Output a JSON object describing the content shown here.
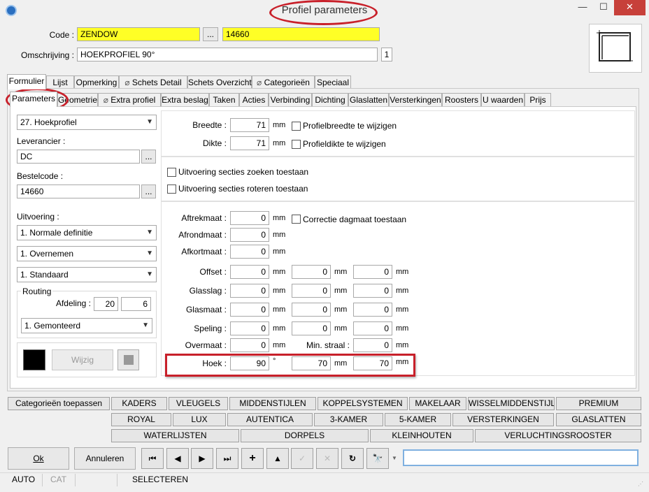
{
  "window": {
    "title": "Profiel parameters",
    "minimize": "—",
    "maximize": "☐",
    "close": "✕"
  },
  "header": {
    "code_label": "Code :",
    "code_value": "ZENDOW",
    "code_browse": "...",
    "code_number": "14660",
    "omschrijving_label": "Omschrijving :",
    "omschrijving_value": "HOEKPROFIEL 90°",
    "omschrijving_count": "1"
  },
  "tabs_main": [
    "Formulier",
    "Lijst",
    "Opmerking",
    "Schets Detail",
    "Schets Overzicht",
    "Categorieën",
    "Speciaal"
  ],
  "tabs_sub": [
    "Parameters",
    "Geometrie",
    "Extra profiel",
    "Extra beslag",
    "Taken",
    "Acties",
    "Verbinding",
    "Dichting",
    "Glaslatten",
    "Versterkingen",
    "Roosters",
    "U waarden",
    "Prijs"
  ],
  "left": {
    "profile_type": "27. Hoekprofiel",
    "leverancier_label": "Leverancier :",
    "leverancier_value": "DC",
    "bestelcode_label": "Bestelcode :",
    "bestelcode_value": "14660",
    "browse": "...",
    "uitvoering_label": "Uitvoering :",
    "uitvoering_1": "1.  Normale definitie",
    "uitvoering_2": "1.  Overnemen",
    "uitvoering_3": "1.  Standaard",
    "routing_label": "Routing",
    "afdeling_label": "Afdeling :",
    "afdeling_1": "20",
    "afdeling_2": "6",
    "routing_select": "1.  Gemonteerd",
    "wijzig_label": "Wijzig"
  },
  "right": {
    "breedte_label": "Breedte :",
    "breedte_value": "71",
    "dikte_label": "Dikte :",
    "dikte_value": "71",
    "unit_mm": "mm",
    "chk_breedte": "Profielbreedte te wijzigen",
    "chk_dikte": "Profieldikte te wijzigen",
    "chk_zoeken": "Uitvoering secties zoeken toestaan",
    "chk_roteren": "Uitvoering secties roteren toestaan",
    "aftrekmaat_label": "Aftrekmaat :",
    "aftrekmaat": "0",
    "chk_correctie": "Correctie dagmaat toestaan",
    "afrondmaat_label": "Afrondmaat :",
    "afrondmaat": "0",
    "afkortmaat_label": "Afkortmaat :",
    "afkortmaat": "0",
    "offset_label": "Offset :",
    "offset": [
      "0",
      "0",
      "0"
    ],
    "glasslag_label": "Glasslag :",
    "glasslag": [
      "0",
      "0",
      "0"
    ],
    "glasmaat_label": "Glasmaat :",
    "glasmaat": [
      "0",
      "0",
      "0"
    ],
    "speling_label": "Speling :",
    "speling": [
      "0",
      "0",
      "0"
    ],
    "overmaat_label": "Overmaat :",
    "overmaat": "0",
    "min_straal_label": "Min. straal :",
    "min_straal": "0",
    "hoek_label": "Hoek :",
    "hoek": [
      "90",
      "70",
      "70"
    ],
    "unit_deg": "°"
  },
  "categories": {
    "apply": "Categorieën toepassen",
    "row1": [
      "KADERS",
      "VLEUGELS",
      "MIDDENSTIJLEN",
      "KOPPELSYSTEMEN",
      "MAKELAAR",
      "WISSELMIDDENSTIJL",
      "PREMIUM"
    ],
    "row2": [
      "ROYAL",
      "LUX",
      "AUTENTICA",
      "3-KAMER",
      "5-KAMER",
      "VERSTERKINGEN",
      "GLASLATTEN"
    ],
    "row3": [
      "WATERLIJSTEN",
      "DORPELS",
      "KLEINHOUTEN",
      "VERLUCHTINGSROOSTER"
    ]
  },
  "footer": {
    "ok": "Ok",
    "annuleren": "Annuleren",
    "search_value": ""
  },
  "status": {
    "auto": "AUTO",
    "cat": "CAT",
    "mode": "SELECTEREN"
  }
}
